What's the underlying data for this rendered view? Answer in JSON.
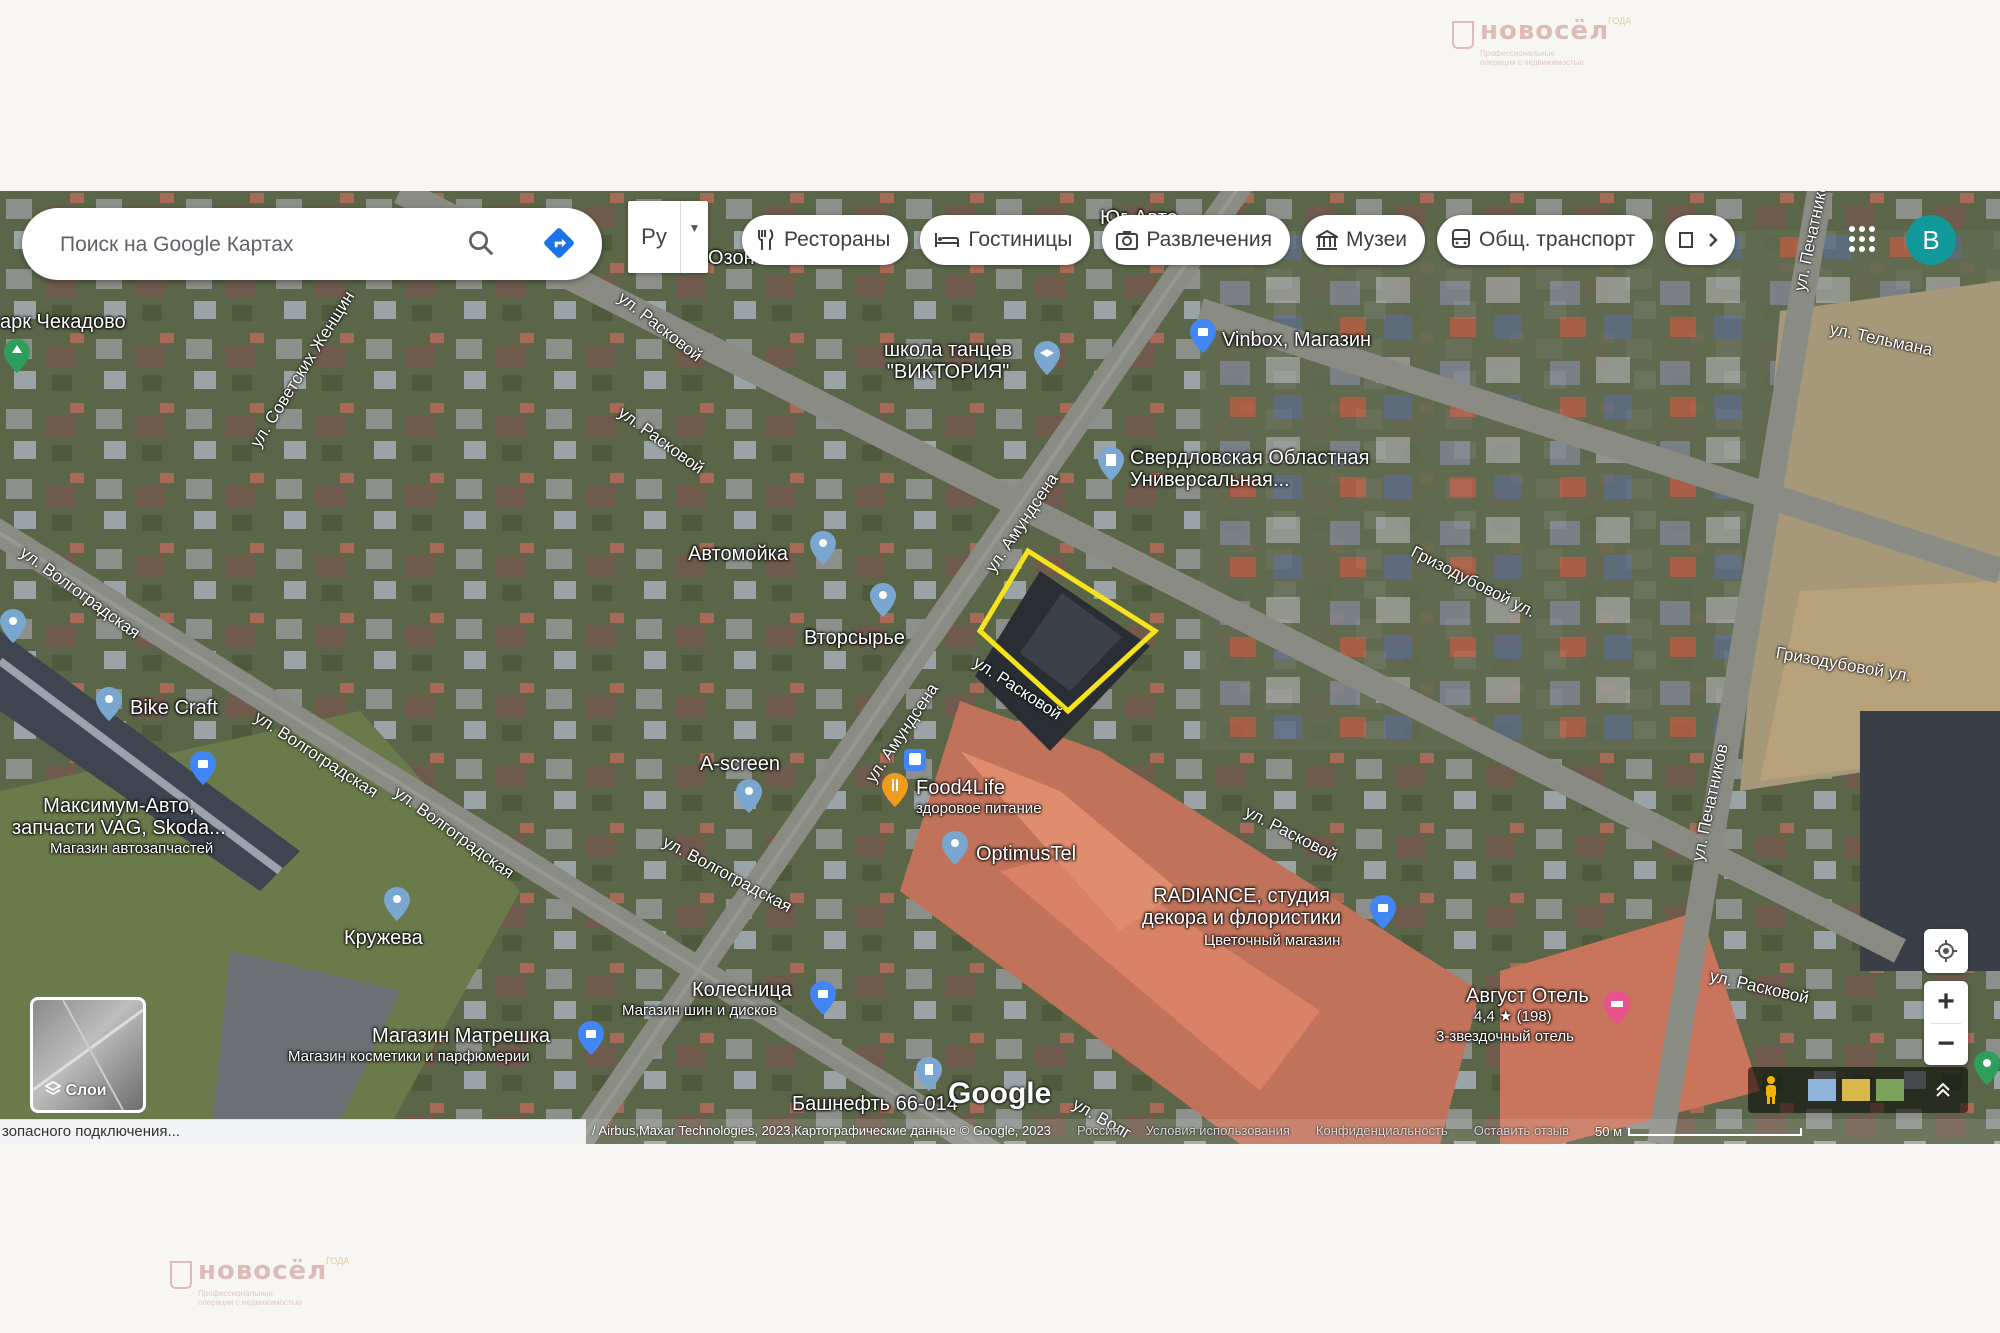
{
  "watermark": {
    "brand": "новосёл",
    "tagline": "Профессиональные операции с недвижимостью",
    "year_label": "ГОДА"
  },
  "search": {
    "placeholder": "Поиск на Google Картах"
  },
  "language": "Ру",
  "chips": [
    {
      "label": "Рестораны",
      "icon": "fork-knife-icon"
    },
    {
      "label": "Гостиницы",
      "icon": "bed-icon"
    },
    {
      "label": "Развлечения",
      "icon": "camera-icon"
    },
    {
      "label": "Музеи",
      "icon": "museum-icon"
    },
    {
      "label": "Общ. транспорт",
      "icon": "bus-icon"
    }
  ],
  "account_initial": "В",
  "places": {
    "park": "арк Чекадово",
    "dance_school": "школа танцев\n\"ВИКТОРИЯ\"",
    "vinbox": "Vinbox, Магазин",
    "library": "Свердловская Областная\nУниверсальная...",
    "car_wash": "Автомойка",
    "recycling": "Вторсырье",
    "bike_craft": "Bike Craft",
    "maximum_auto": "Максимум-Авто,\nзапчасти VAG, Skoda...",
    "maximum_auto_sub": "Магазин автозапчастей",
    "a_screen": "A-screen",
    "food4life": "Food4Life",
    "food4life_sub": "здоровое питание",
    "optimustel": "OptimusTel",
    "radiance": "RADIANCE, студия\nдекора и флористики",
    "radiance_sub": "Цветочный магазин",
    "lace": "Кружева",
    "chariot": "Колесница",
    "chariot_sub": "Магазин шин и дисков",
    "matryoshka": "Магазин Матрешка",
    "matryoshka_sub": "Магазин косметики и парфюмерии",
    "bashneft": "Башнефть 66-014",
    "august_hotel": "Август Отель",
    "august_rating": "4,4 ★ (198)",
    "august_sub": "3-звездочный отель",
    "yug_avto": "Юг-Авто",
    "ozon": "Озон"
  },
  "roads": {
    "raskovoy": "ул. Расковой",
    "amundsena": "ул. Амундсена",
    "volgogradskaya": "ул. Волгоградская",
    "sovetskikh_zhenshchin": "ул. Советских Женщин",
    "griozoduboboy": "Гризодубовой ул.",
    "telmana": "ул. Тельмана",
    "pechatnikov": "ул. Печатников",
    "volg_short": "ул. Волг"
  },
  "layers_label": "Слои",
  "status_text": "зопасного подключения...",
  "google_logo": "Google",
  "attribution": {
    "data": "/ Airbus,Maxar Technologies, 2023,Картографические данные © Google, 2023",
    "country": "Россия",
    "terms": "Условия использования",
    "privacy": "Конфиденциальность",
    "feedback": "Оставить отзыв",
    "scale": "50 м"
  },
  "colors": {
    "highlight": "#f5e41c",
    "avatar": "#129a9a",
    "pin": "#7aa7cf"
  }
}
